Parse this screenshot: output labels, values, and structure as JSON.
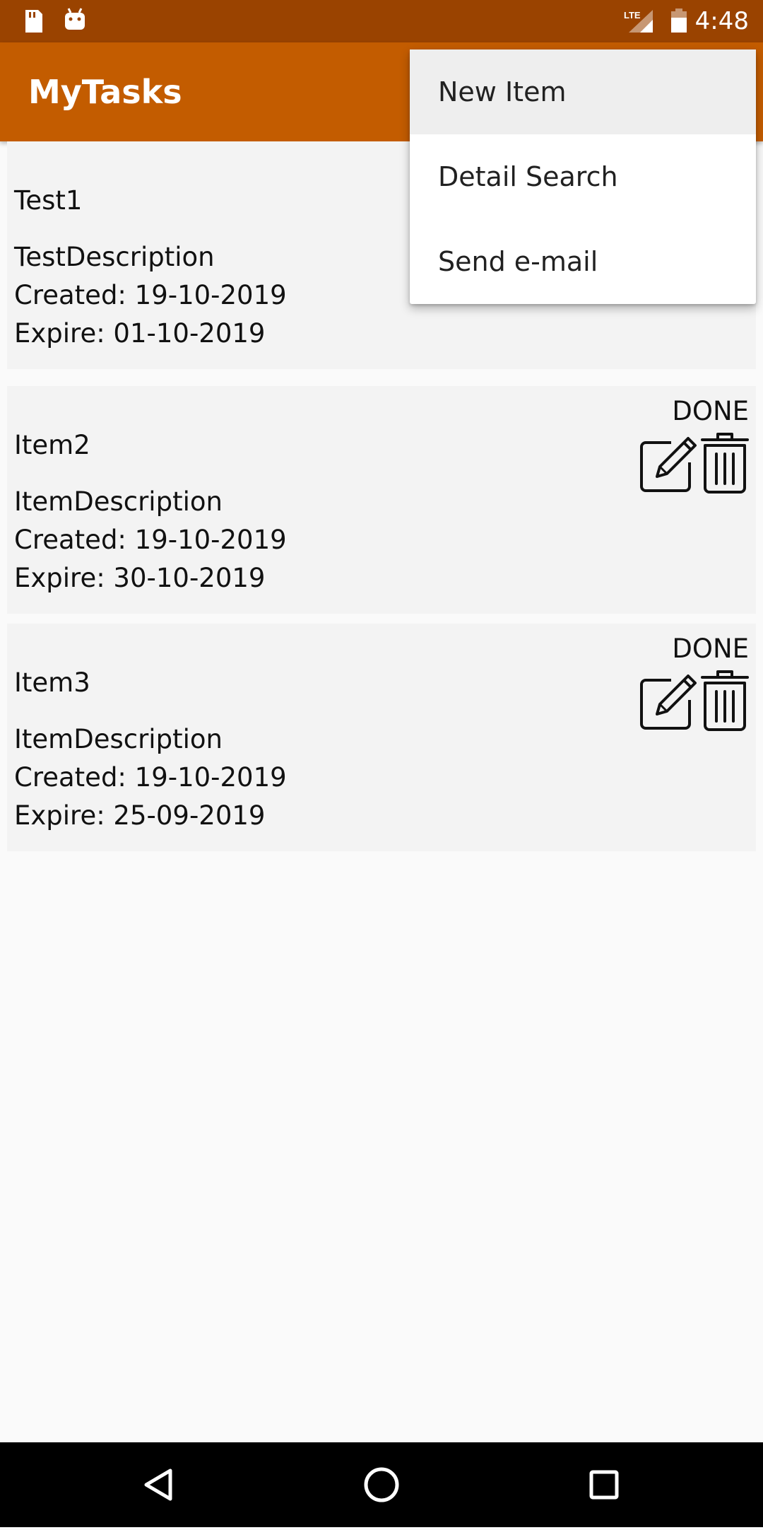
{
  "status_bar": {
    "time": "4:48",
    "left_icons": [
      "sd-card-icon",
      "android-icon"
    ],
    "right_icons": [
      "lte-signal-icon",
      "battery-icon"
    ]
  },
  "app_bar": {
    "title": "MyTasks"
  },
  "menu": {
    "items": [
      {
        "label": "New Item",
        "highlighted": true
      },
      {
        "label": "Detail Search",
        "highlighted": false
      },
      {
        "label": "Send e-mail",
        "highlighted": false
      }
    ]
  },
  "tasks": [
    {
      "title": "Test1",
      "description": "TestDescription",
      "created": "Created:  19-10-2019",
      "expire": "Expire:  01-10-2019",
      "status": ""
    },
    {
      "title": "Item2",
      "description": "ItemDescription",
      "created": "Created:  19-10-2019",
      "expire": "Expire:  30-10-2019",
      "status": "DONE"
    },
    {
      "title": "Item3",
      "description": "ItemDescription",
      "created": "Created:  19-10-2019",
      "expire": "Expire:  25-09-2019",
      "status": "DONE"
    }
  ],
  "nav_bar": {
    "buttons": [
      "back-icon",
      "home-icon",
      "recents-icon"
    ]
  },
  "colors": {
    "status_bar": "#9a4300",
    "app_bar": "#c35c00",
    "background": "#fafafa",
    "card": "#f3f3f3"
  }
}
